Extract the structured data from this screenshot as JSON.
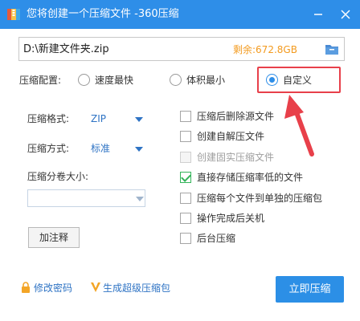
{
  "window": {
    "title": "您将创建一个压缩文件 -360压缩",
    "accent_color": "#2e8ee8"
  },
  "path": {
    "value": "D:\\新建文件夹.zip",
    "free_space": "剩余:672.8GB"
  },
  "config": {
    "label": "压缩配置:",
    "options": [
      {
        "label": "速度最快",
        "checked": false
      },
      {
        "label": "体积最小",
        "checked": false
      },
      {
        "label": "自定义",
        "checked": true
      }
    ]
  },
  "settings": {
    "format_label": "压缩格式:",
    "format_value": "ZIP",
    "method_label": "压缩方式:",
    "method_value": "标准",
    "split_label": "压缩分卷大小:",
    "split_value": "",
    "note_button": "加注释"
  },
  "checkboxes": [
    {
      "label": "压缩后删除源文件",
      "checked": false,
      "disabled": false
    },
    {
      "label": "创建自解压文件",
      "checked": false,
      "disabled": false
    },
    {
      "label": "创建固实压缩文件",
      "checked": false,
      "disabled": true
    },
    {
      "label": "直接存储压缩率低的文件",
      "checked": true,
      "disabled": false
    },
    {
      "label": "压缩每个文件到单独的压缩包",
      "checked": false,
      "disabled": false
    },
    {
      "label": "操作完成后关机",
      "checked": false,
      "disabled": false
    },
    {
      "label": "后台压缩",
      "checked": false,
      "disabled": false
    }
  ],
  "footer": {
    "password_link": "修改密码",
    "super_link": "生成超级压缩包",
    "compress_button": "立即压缩"
  }
}
